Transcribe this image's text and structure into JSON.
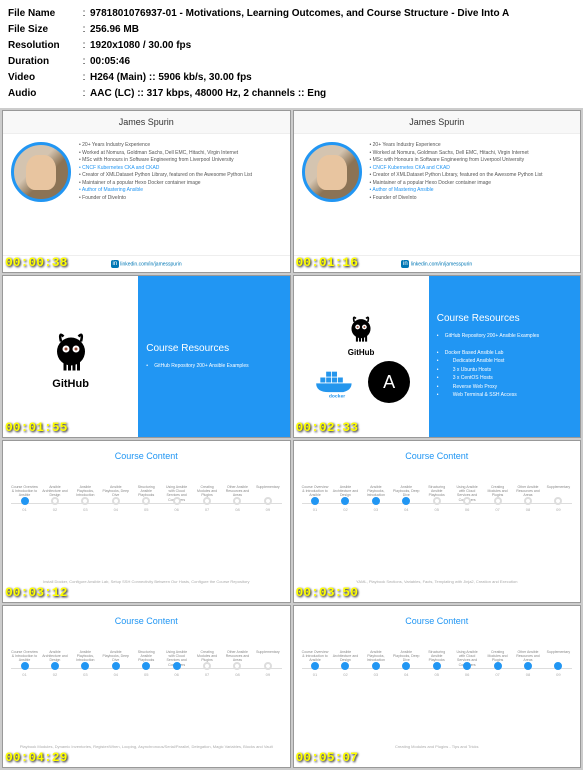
{
  "metadata": {
    "filename_label": "File Name",
    "filename": "9781801076937-01 - Motivations, Learning Outcomes, and Course Structure - Dive Into A",
    "filesize_label": "File Size",
    "filesize": "256.96 MB",
    "resolution_label": "Resolution",
    "resolution": "1920x1080 / 30.00 fps",
    "duration_label": "Duration",
    "duration": "00:05:46",
    "video_label": "Video",
    "video": "H264 (Main) :: 5906 kb/s, 30.00 fps",
    "audio_label": "Audio",
    "audio": "AAC (LC) :: 317 kbps, 48000 Hz, 2 channels :: Eng"
  },
  "thumbnails": [
    {
      "ts": "00:00:38",
      "type": "bio"
    },
    {
      "ts": "00:01:16",
      "type": "bio"
    },
    {
      "ts": "00:01:55",
      "type": "res1"
    },
    {
      "ts": "00:02:33",
      "type": "res2"
    },
    {
      "ts": "00:03:12",
      "type": "tl",
      "active": 0
    },
    {
      "ts": "00:03:50",
      "type": "tl",
      "active": 3
    },
    {
      "ts": "00:04:29",
      "type": "tl",
      "active": 5
    },
    {
      "ts": "00:05:07",
      "type": "tl",
      "active": 8
    }
  ],
  "bio": {
    "name": "James Spurin",
    "items": [
      {
        "t": "20+ Years Industry Experience"
      },
      {
        "t": "Worked at Nomura, Goldman Sachs, Dell EMC, Hitachi, Virgin Internet"
      },
      {
        "t": "MSc with Honours in Software Engineering from Liverpool University"
      },
      {
        "t": "CNCF Kubernetes CKA and CKAD",
        "hl": true
      },
      {
        "t": "Creator of XMLDataset Python Library, featured on the Awesome Python List"
      },
      {
        "t": "Maintainer of a popular Hexo Docker container image"
      },
      {
        "t": "Author of Mastering Ansible",
        "hl": true
      },
      {
        "t": "Founder of DiveInto"
      }
    ],
    "linkedin": "linkedin.com/in/jamesspurin"
  },
  "resources": {
    "title": "Course Resources",
    "github_label": "GitHub",
    "docker_label": "docker",
    "ansible_label": "ANSIBLE",
    "item1": "GitHub Repository 200+ Ansible Examples",
    "lab_title": "Docker Based Ansible Lab",
    "lab_items": [
      "Dedicated Ansible Host",
      "3 x Ubuntu Hosts",
      "3 x CentOS Hosts",
      "Reverse Web Proxy",
      "Web Terminal & SSH Access"
    ]
  },
  "timeline": {
    "title": "Course Content",
    "nodes": [
      {
        "num": "01",
        "label": "Course Overview & Introduction to Ansible"
      },
      {
        "num": "02",
        "label": "Ansible Architecture and Design"
      },
      {
        "num": "03",
        "label": "Ansible Playbooks, Introduction"
      },
      {
        "num": "04",
        "label": "Ansible Playbooks, Deep Dive"
      },
      {
        "num": "05",
        "label": "Structuring Ansible Playbooks"
      },
      {
        "num": "06",
        "label": "Using Ansible with Cloud Services and Containers"
      },
      {
        "num": "07",
        "label": "Creating Modules and Plugins"
      },
      {
        "num": "08",
        "label": "Other Ansible Resources and Areas"
      },
      {
        "num": "09",
        "label": "Supplementary"
      }
    ],
    "footers": [
      "Install Docker, Configure Ansible Lab, Setup SSH Connectivity Between Our Hosts, Configure the Course Repository",
      "YAML, Playbook Sections, Variables, Facts, Templating with Jinja2, Creation and Execution",
      "Playbook Modules, Dynamic Inventories, Register/When, Looping, Asynchronous/Serial/Parallel, Delegation, Magic Variables, Blocks and Vault",
      "Creating Modules and Plugins - Tips and Tricks"
    ]
  }
}
